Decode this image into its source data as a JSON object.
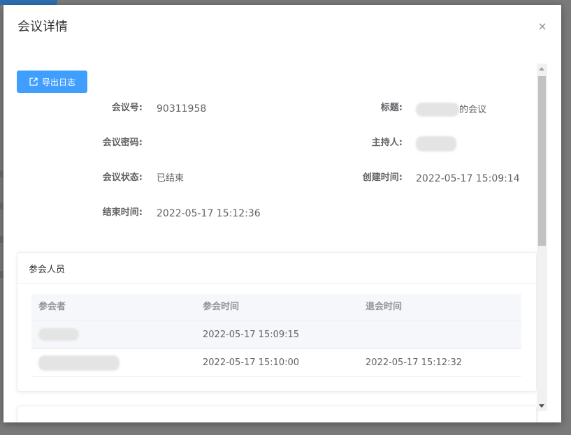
{
  "modal": {
    "title": "会议详情",
    "close_glyph": "×",
    "export_label": "导出日志"
  },
  "details": {
    "meeting_id_label": "会议号:",
    "meeting_id_value": "90311958",
    "title_label": "标题:",
    "title_suffix": "的会议",
    "password_label": "会议密码:",
    "password_value": "",
    "host_label": "主持人:",
    "status_label": "会议状态:",
    "status_value": "已结束",
    "created_label": "创建时间:",
    "created_value": "2022-05-17 15:09:14",
    "ended_label": "结束时间:",
    "ended_value": "2022-05-17 15:12:36"
  },
  "participants": {
    "panel_title": "参会人员",
    "columns": [
      "参会者",
      "参会时间",
      "退会时间"
    ],
    "rows": [
      {
        "name": "",
        "join_time": "2022-05-17 15:09:15",
        "leave_time": ""
      },
      {
        "name": "",
        "join_time": "2022-05-17 15:10:00",
        "leave_time": "2022-05-17 15:12:32"
      }
    ]
  },
  "icons": {
    "export": "export-icon",
    "close": "close-icon"
  },
  "colors": {
    "primary": "#409eff",
    "overlay": "#7a7a7a",
    "header_bg": "#f5f7fa"
  }
}
